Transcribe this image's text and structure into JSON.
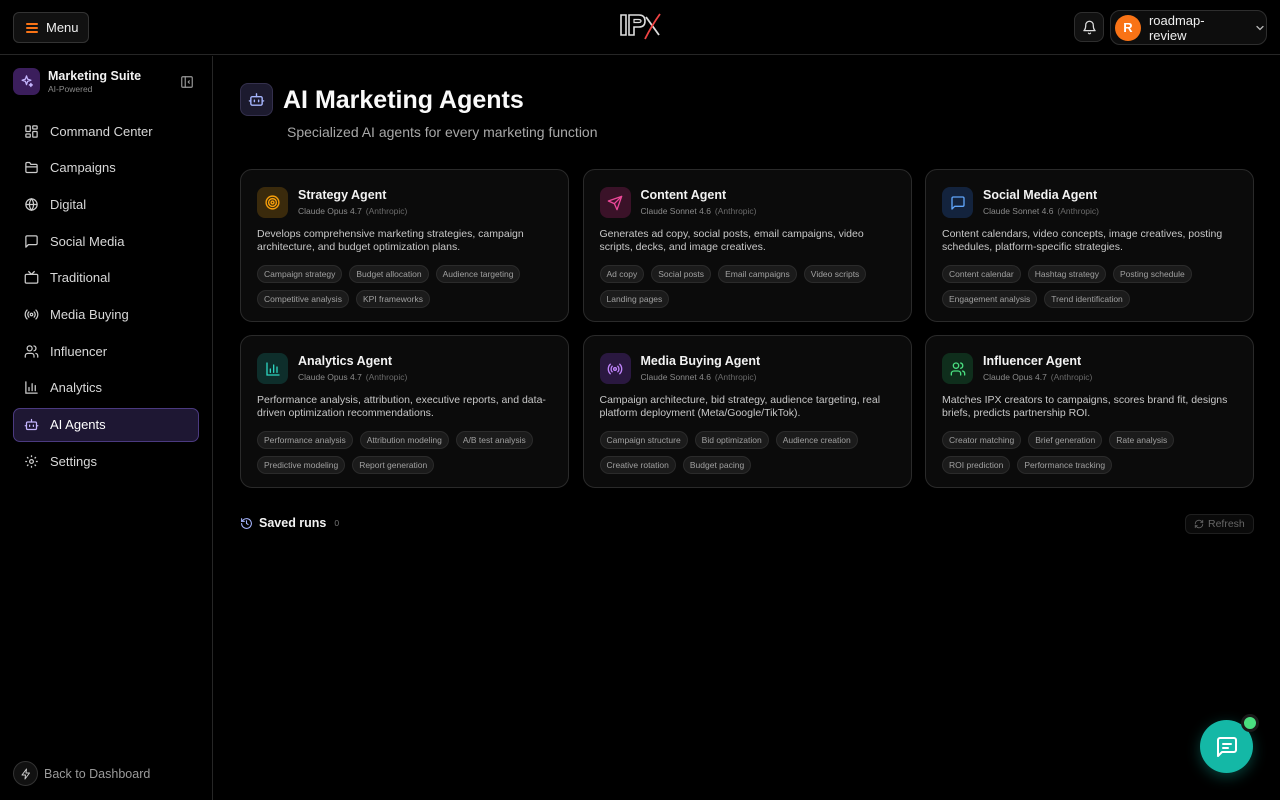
{
  "topbar": {
    "menu_label": "Menu",
    "user_initial": "R",
    "user_name": "roadmap-review"
  },
  "sidebar": {
    "brand_title": "Marketing Suite",
    "brand_sub": "AI-Powered",
    "items": [
      {
        "label": "Command Center",
        "icon": "grid-icon"
      },
      {
        "label": "Campaigns",
        "icon": "folder-icon"
      },
      {
        "label": "Digital",
        "icon": "globe-icon"
      },
      {
        "label": "Social Media",
        "icon": "message-icon"
      },
      {
        "label": "Traditional",
        "icon": "tv-icon"
      },
      {
        "label": "Media Buying",
        "icon": "radio-icon"
      },
      {
        "label": "Influencer",
        "icon": "users-icon"
      },
      {
        "label": "Analytics",
        "icon": "bar-chart-icon"
      },
      {
        "label": "AI Agents",
        "icon": "bot-icon",
        "active": true
      },
      {
        "label": "Settings",
        "icon": "gear-icon"
      }
    ],
    "back_label": "Back to Dashboard"
  },
  "main": {
    "title": "AI Marketing Agents",
    "subtitle": "Specialized AI agents for every marketing function",
    "agents": [
      {
        "name": "Strategy Agent",
        "model": "Claude Opus 4.7",
        "provider": "(Anthropic)",
        "desc": "Develops comprehensive marketing strategies, campaign architecture, and budget optimization plans.",
        "tags": [
          "Campaign strategy",
          "Budget allocation",
          "Audience targeting",
          "Competitive analysis",
          "KPI frameworks"
        ],
        "icon": "target-icon",
        "color": "#f59e0b",
        "bg": "#3a2a0c"
      },
      {
        "name": "Content Agent",
        "model": "Claude Sonnet 4.6",
        "provider": "(Anthropic)",
        "desc": "Generates ad copy, social posts, email campaigns, video scripts, decks, and image creatives.",
        "tags": [
          "Ad copy",
          "Social posts",
          "Email campaigns",
          "Video scripts",
          "Landing pages"
        ],
        "icon": "send-icon",
        "color": "#ec4899",
        "bg": "#3a1228"
      },
      {
        "name": "Social Media Agent",
        "model": "Claude Sonnet 4.6",
        "provider": "(Anthropic)",
        "desc": "Content calendars, video concepts, image creatives, posting schedules, platform-specific strategies.",
        "tags": [
          "Content calendar",
          "Hashtag strategy",
          "Posting schedule",
          "Engagement analysis",
          "Trend identification"
        ],
        "icon": "chat-icon",
        "color": "#60a5fa",
        "bg": "#13233d"
      },
      {
        "name": "Analytics Agent",
        "model": "Claude Opus 4.7",
        "provider": "(Anthropic)",
        "desc": "Performance analysis, attribution, executive reports, and data-driven optimization recommendations.",
        "tags": [
          "Performance analysis",
          "Attribution modeling",
          "A/B test analysis",
          "Predictive modeling",
          "Report generation"
        ],
        "icon": "bar-chart-icon",
        "color": "#2dd4bf",
        "bg": "#0e2e2b"
      },
      {
        "name": "Media Buying Agent",
        "model": "Claude Sonnet 4.6",
        "provider": "(Anthropic)",
        "desc": "Campaign architecture, bid strategy, audience targeting, real platform deployment (Meta/Google/TikTok).",
        "tags": [
          "Campaign structure",
          "Bid optimization",
          "Audience creation",
          "Creative rotation",
          "Budget pacing"
        ],
        "icon": "broadcast-icon",
        "color": "#c084fc",
        "bg": "#2a1840"
      },
      {
        "name": "Influencer Agent",
        "model": "Claude Opus 4.7",
        "provider": "(Anthropic)",
        "desc": "Matches IPX creators to campaigns, scores brand fit, designs briefs, predicts partnership ROI.",
        "tags": [
          "Creator matching",
          "Brief generation",
          "Rate analysis",
          "ROI prediction",
          "Performance tracking"
        ],
        "icon": "users-icon",
        "color": "#4ade80",
        "bg": "#0f2e1c"
      }
    ],
    "saved_label": "Saved runs",
    "saved_count": "0",
    "refresh_label": "Refresh"
  }
}
